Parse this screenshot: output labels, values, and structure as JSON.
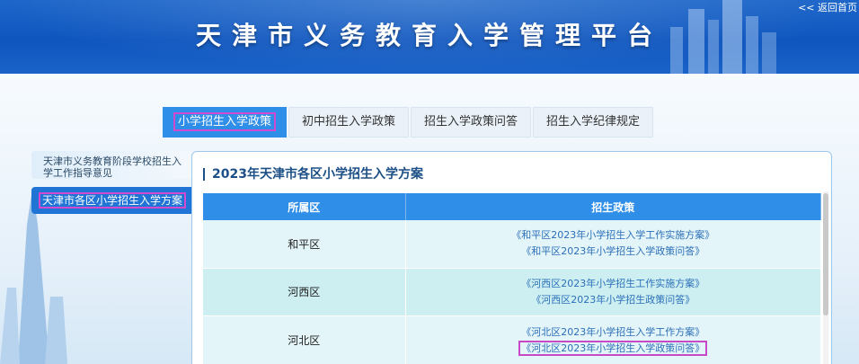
{
  "header": {
    "title": "天津市义务教育入学管理平台",
    "home_link": "<< 返回首页"
  },
  "tabs": [
    {
      "label": "小学招生入学政策",
      "active": true
    },
    {
      "label": "初中招生入学政策",
      "active": false
    },
    {
      "label": "招生入学政策问答",
      "active": false
    },
    {
      "label": "招生入学纪律规定",
      "active": false
    }
  ],
  "sidebar": {
    "items": [
      {
        "label": "天津市义务教育阶段学校招生入学工作指导意见",
        "active": false
      },
      {
        "label": "天津市各区小学招生入学方案",
        "active": true
      }
    ]
  },
  "panel": {
    "title": "2023年天津市各区小学招生入学方案",
    "columns": [
      "所属区",
      "招生政策"
    ],
    "rows": [
      {
        "district": "和平区",
        "links": [
          "《和平区2023年小学招生入学工作实施方案》",
          "《和平区2023年小学招生入学政策问答》"
        ]
      },
      {
        "district": "河西区",
        "links": [
          "《河西区2023年小学招生工作实施方案》",
          "《河西区2023年小学招生政策问答》"
        ]
      },
      {
        "district": "河北区",
        "links": [
          "《河北区2023年小学招生入学工作方案》",
          "《河北区2023年小学招生入学政策问答》"
        ]
      }
    ]
  },
  "colors": {
    "header_blue": "#1560c4",
    "tab_active": "#2f8ee8",
    "highlight": "#d24ad0",
    "link": "#2c6fb8"
  }
}
